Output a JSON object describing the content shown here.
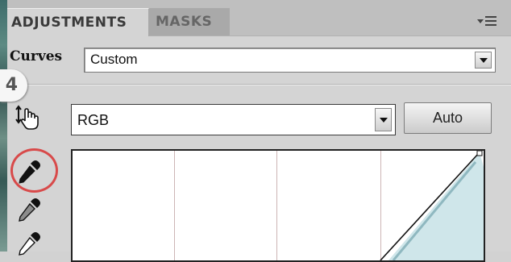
{
  "tabs": {
    "adjustments": "ADJUSTMENTS",
    "masks": "MASKS"
  },
  "preset": {
    "label": "Curves",
    "value": "Custom"
  },
  "badge": {
    "step": "4"
  },
  "channel": {
    "value": "RGB"
  },
  "auto_button": {
    "label": "Auto"
  },
  "icons": {
    "panel_menu": "panel-menu-icon",
    "hand_tool": "on-image-adjust-hand-icon",
    "black_point": "eyedropper-black-icon",
    "gray_point": "eyedropper-gray-icon",
    "white_point": "eyedropper-white-icon"
  },
  "colors": {
    "highlight_ring": "#d84a4a",
    "histogram_fill": "#cfe6ea",
    "panel_bg": "#d4d4d4"
  }
}
